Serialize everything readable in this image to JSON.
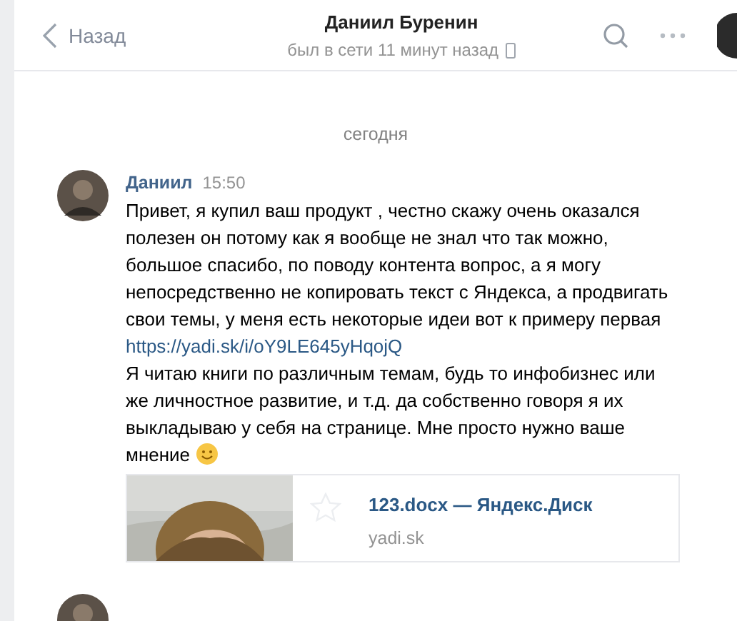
{
  "header": {
    "back_label": "Назад",
    "title": "Даниил Буренин",
    "status": "был в сети 11 минут назад"
  },
  "date_divider": "сегодня",
  "messages": [
    {
      "author": "Даниил",
      "time": "15:50",
      "text_1": "Привет, я купил ваш продукт , честно скажу очень оказался полезен он потому как я вообще не знал что так можно, большое спасибо, по поводу контента вопрос, а я могу непосредственно не копировать текст с Яндекса, а продвигать свои темы, у меня есть некоторые идеи вот к примеру первая",
      "link": "https://yadi.sk/i/oY9LE645yHqojQ",
      "text_2": "Я читаю книги по различным темам, будь то инфобизнес или же личностное развитие, и т.д. да собственно говоря я их выкладываю у себя на странице. Мне просто нужно ваше мнение",
      "attachment": {
        "kind": "picture",
        "title": "123.docx — Яндекс.Диск",
        "domain": "yadi.sk"
      }
    }
  ]
}
